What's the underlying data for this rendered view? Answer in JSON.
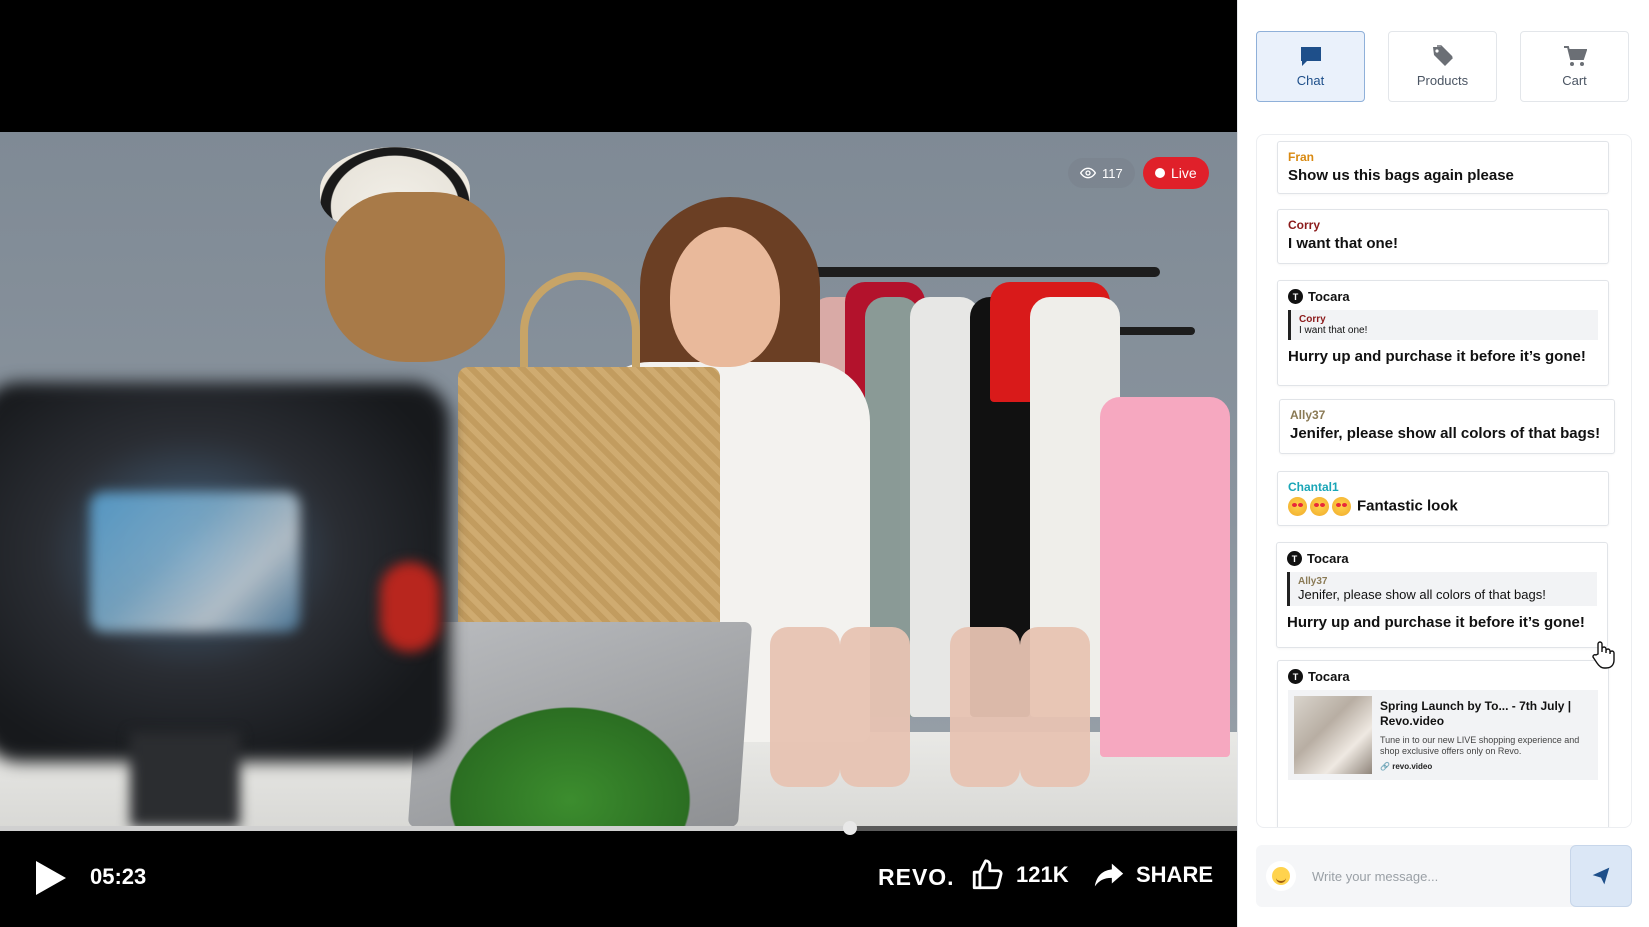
{
  "video": {
    "viewer_count": "117",
    "live_label": "Live",
    "time": "05:23",
    "progress": 0.687,
    "brand": "REVO.",
    "likes": "121K",
    "share_label": "SHARE"
  },
  "tabs": [
    {
      "label": "Chat",
      "icon": "chat-icon",
      "active": true
    },
    {
      "label": "Products",
      "icon": "tag-icon",
      "active": false
    },
    {
      "label": "Cart",
      "icon": "cart-icon",
      "active": false
    }
  ],
  "colors": {
    "live": "#e0202a",
    "accent": "#1e4f8a",
    "fran": "#d98a12",
    "corry": "#8b1a1a",
    "ally": "#8a7a55",
    "chantal": "#1aa6b7"
  },
  "chat": {
    "messages": [
      {
        "user": "Fran",
        "text": "Show us this bags again please"
      },
      {
        "user": "Corry",
        "text": "I want that one!"
      },
      {
        "host": "Tocara",
        "host_initial": "T",
        "quote_user": "Corry",
        "quote_text": "I want that one!",
        "text": "Hurry up and purchase it before it’s gone!"
      },
      {
        "user": "Ally37",
        "text": "Jenifer, please show all colors of that bags!"
      },
      {
        "user": "Chantal1",
        "text": "Fantastic look"
      },
      {
        "host": "Tocara",
        "host_initial": "T",
        "quote_user": "Ally37",
        "quote_text": "Jenifer, please show all colors of that bags!",
        "text": "Hurry up and purchase it before it’s gone!"
      },
      {
        "host": "Tocara",
        "host_initial": "T",
        "link_title": "Spring Launch  by To... - 7th July | Revo.video",
        "link_desc": "Tune in to our new LIVE shopping experience and shop exclusive offers only on Revo.",
        "link_url": "revo.video"
      }
    ]
  },
  "composer": {
    "placeholder": "Write your message..."
  }
}
